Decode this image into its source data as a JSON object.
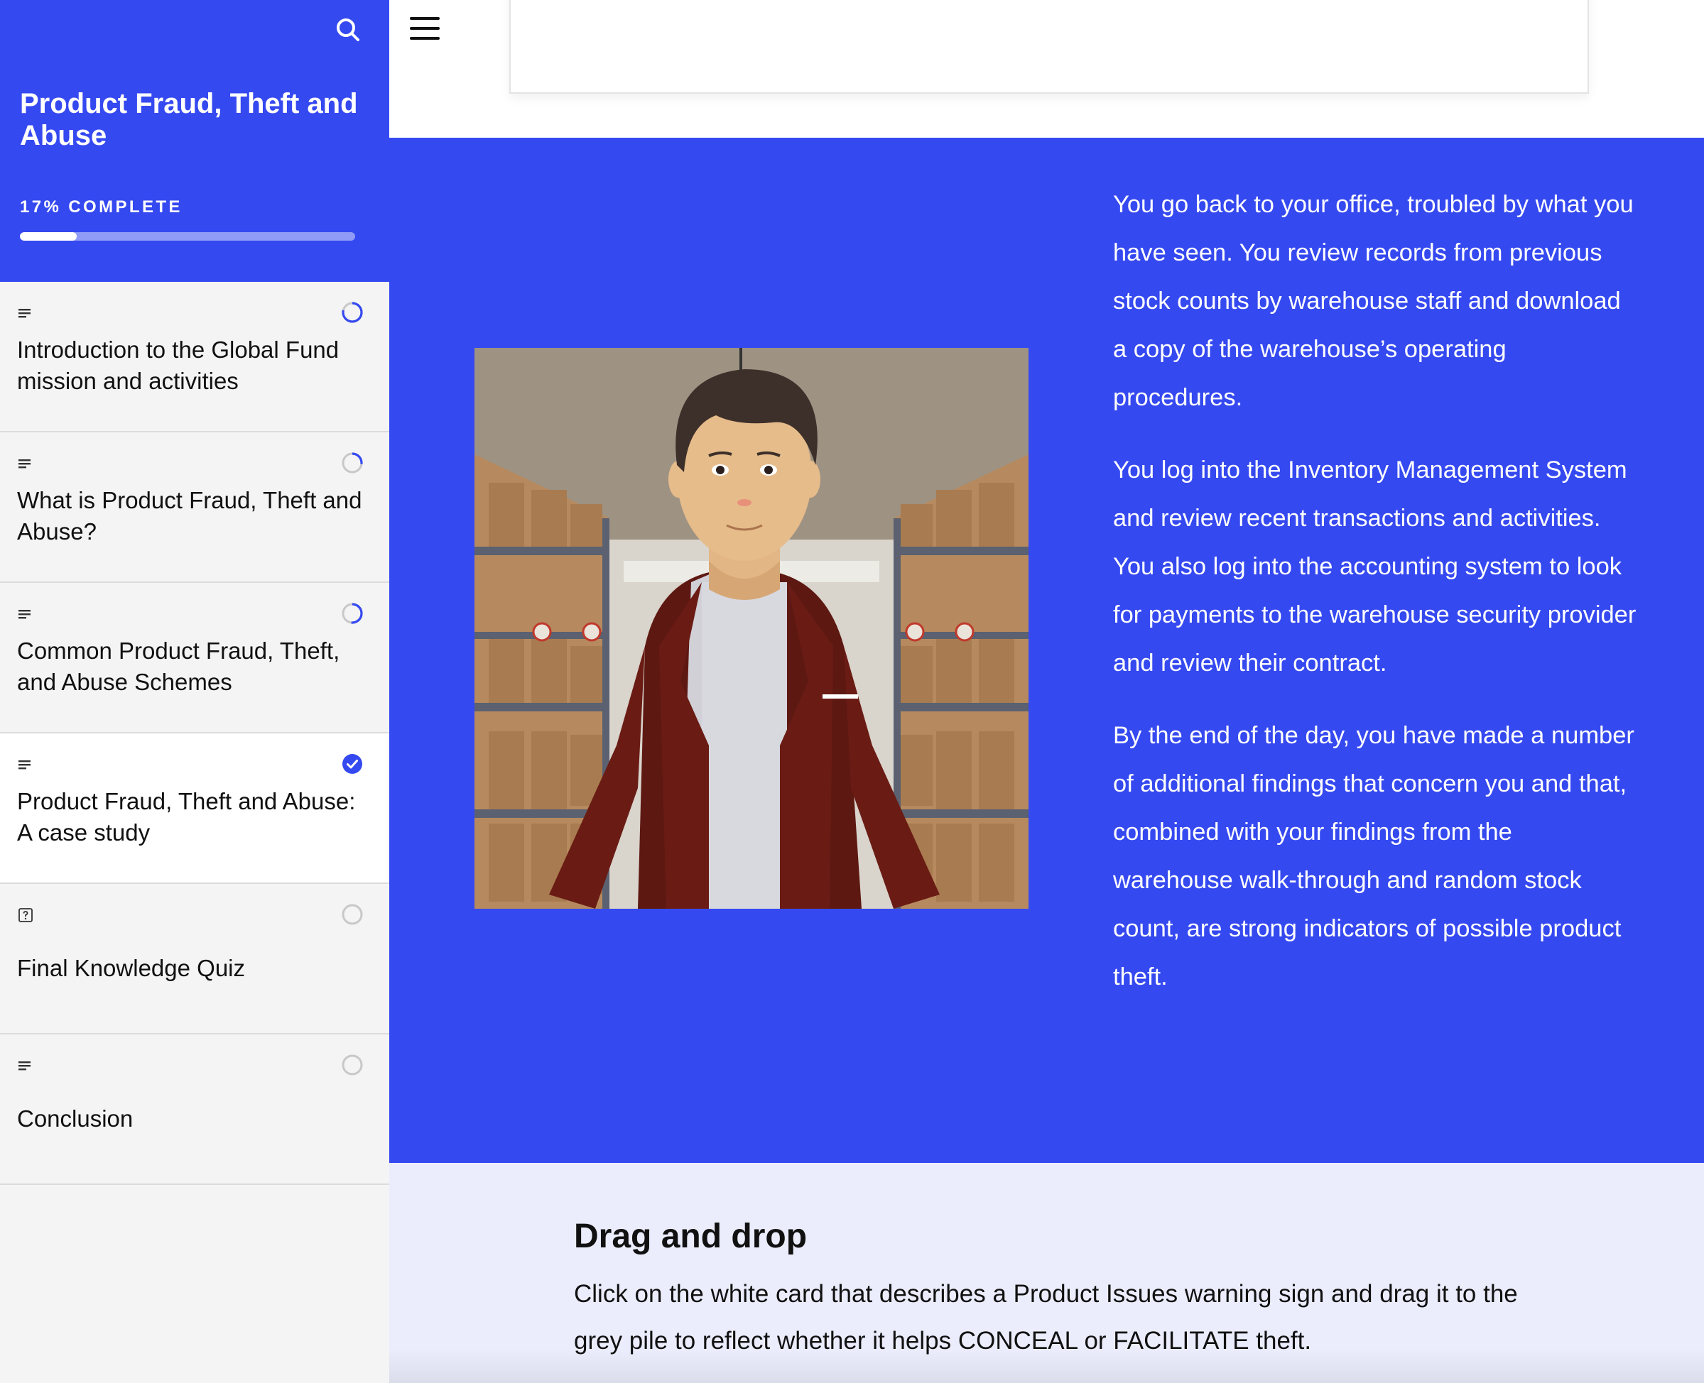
{
  "sidebar": {
    "course_title": "Product Fraud, Theft and Abuse",
    "progress": {
      "label": "17% COMPLETE",
      "percent": 17
    },
    "search_icon": "search-icon",
    "lessons": [
      {
        "title": "Introduction to the Global Fund mission and activities",
        "type_icon": "text-lines-icon",
        "status": "in-progress"
      },
      {
        "title": "What is Product Fraud, Theft and Abuse?",
        "type_icon": "text-lines-icon",
        "status": "in-progress"
      },
      {
        "title": "Common Product Fraud, Theft, and Abuse Schemes",
        "type_icon": "text-lines-icon",
        "status": "in-progress"
      },
      {
        "title": "Product Fraud, Theft and Abuse: A case study",
        "type_icon": "text-lines-icon",
        "status": "complete"
      },
      {
        "title": "Final Knowledge Quiz",
        "type_icon": "quiz-icon",
        "status": "not-started"
      },
      {
        "title": "Conclusion",
        "type_icon": "text-lines-icon",
        "status": "not-started"
      }
    ]
  },
  "main": {
    "menu_icon": "hamburger-menu-icon",
    "story": {
      "paragraphs": [
        "You go back to your office, troubled by what you have seen. You review records from previous stock counts by warehouse staff and download a copy of the warehouse’s operating procedures.",
        "You log into the Inventory Management System and review recent transactions and activities. You also log into the accounting system to look for payments to the warehouse security provider and review their contract.",
        "By the end of the day, you have made a number of additional findings that concern you and that, combined with your findings from the warehouse walk-through and random stock count, are strong indicators of possible product theft."
      ]
    },
    "quiz": {
      "heading": "Drag and drop",
      "instructions": "Click on the white card that describes a Product Issues warning sign and drag it to the grey pile to reflect whether it helps CONCEAL or FACILITATE theft."
    }
  },
  "colors": {
    "accent": "#3549f0",
    "quiz_background": "#ebedfc",
    "sidebar_background": "#f4f4f4",
    "jacket": "#5e1812",
    "shelf": "#5b6170"
  }
}
